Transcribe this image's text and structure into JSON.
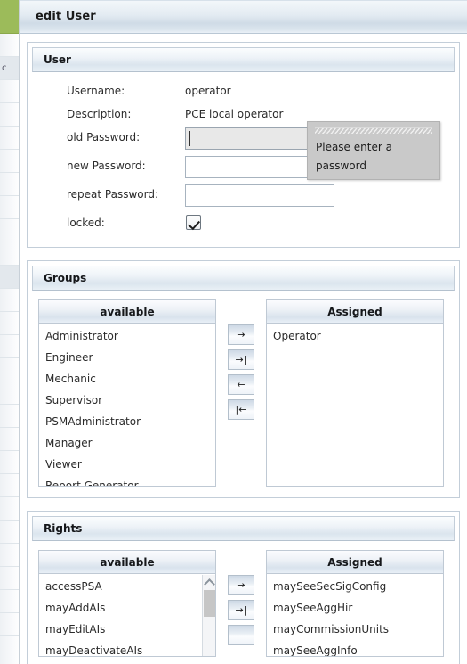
{
  "window": {
    "page_title": "edit User",
    "accent_color": "#9cbb5a"
  },
  "sidebar_fragment": {
    "rows": [
      "",
      "",
      "c",
      "",
      "",
      "",
      "",
      "",
      "",
      "",
      "",
      "",
      "",
      "",
      "",
      "",
      "",
      "",
      "",
      "",
      "",
      "",
      "",
      "",
      "",
      "",
      ""
    ]
  },
  "user_panel": {
    "title": "User",
    "fields": {
      "username_label": "Username:",
      "username_value": "operator",
      "description_label": "Description:",
      "description_value": "PCE local operator",
      "old_password_label": "old Password:",
      "old_password_value": "",
      "new_password_label": "new Password:",
      "new_password_value": "",
      "repeat_password_label": "repeat Password:",
      "repeat_password_value": "",
      "locked_label": "locked:",
      "locked_checked": true
    },
    "tooltip": {
      "text": "Please enter a password"
    }
  },
  "groups_panel": {
    "title": "Groups",
    "available_header": "available",
    "assigned_header": "Assigned",
    "available_items": [
      "Administrator",
      "Engineer",
      "Mechanic",
      "Supervisor",
      "PSMAdministrator",
      "Manager",
      "Viewer",
      "Report Generator"
    ],
    "assigned_items": [
      "Operator"
    ],
    "buttons": [
      {
        "name": "move-right",
        "glyph": "→"
      },
      {
        "name": "move-all-right",
        "glyph": "→|"
      },
      {
        "name": "move-left",
        "glyph": "←"
      },
      {
        "name": "move-all-left",
        "glyph": "|←"
      }
    ]
  },
  "rights_panel": {
    "title": "Rights",
    "available_header": "available",
    "assigned_header": "Assigned",
    "available_items": [
      "accessPSA",
      "mayAddAIs",
      "mayEditAIs",
      "mayDeactivateAIs"
    ],
    "assigned_items": [
      "maySeeSecSigConfig",
      "maySeeAggHir",
      "mayCommissionUnits",
      "maySeeAggInfo"
    ],
    "buttons": [
      {
        "name": "move-right",
        "glyph": "→"
      },
      {
        "name": "move-all-right",
        "glyph": "→|"
      }
    ]
  }
}
